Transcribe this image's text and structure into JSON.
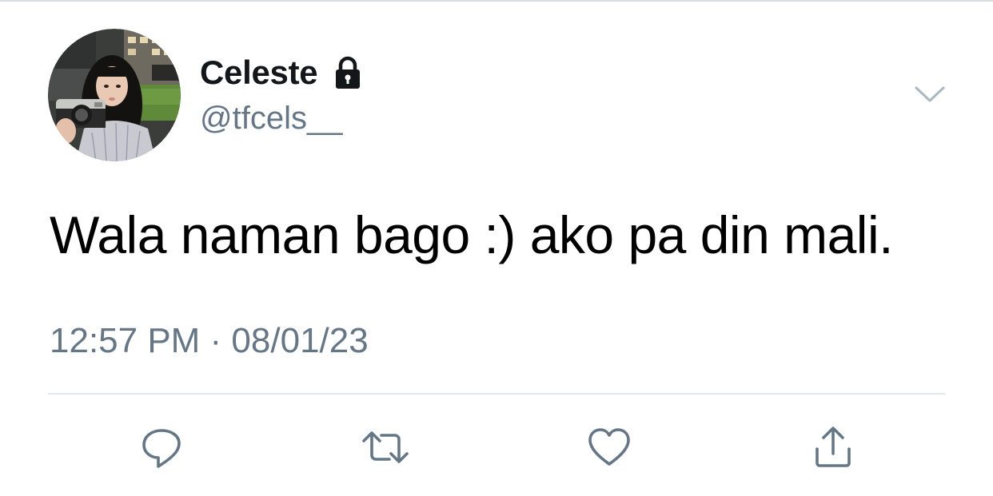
{
  "tweet": {
    "author": {
      "display_name": "Celeste",
      "handle": "@tfcels__",
      "protected_icon": "lock-icon",
      "avatar": "profile-photo"
    },
    "text": "Wala naman bago :) ako pa din mali.",
    "timestamp": "12:57 PM · 08/01/23",
    "menu_icon": "chevron-down-icon",
    "actions": [
      {
        "name": "reply",
        "icon": "reply-icon"
      },
      {
        "name": "retweet",
        "icon": "retweet-icon"
      },
      {
        "name": "like",
        "icon": "heart-icon"
      },
      {
        "name": "share",
        "icon": "share-icon"
      }
    ]
  },
  "colors": {
    "name": "#14171a",
    "secondary": "#657786",
    "text": "#000000",
    "divider": "#e1e8ed",
    "icon": "#657786"
  }
}
